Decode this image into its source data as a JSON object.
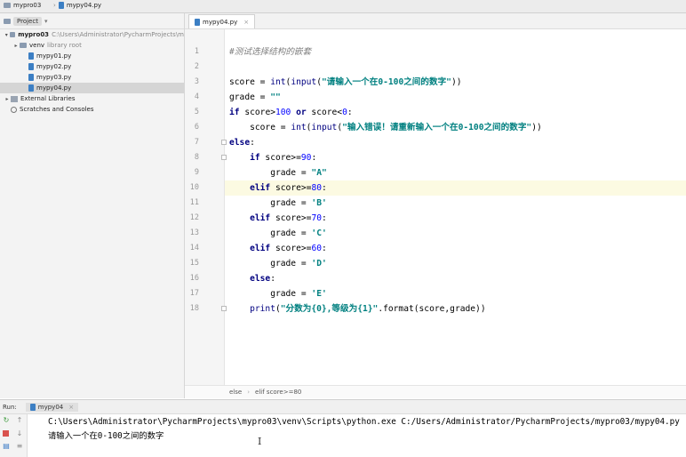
{
  "topbar": {
    "project": "mypro03",
    "file": "mypy04.py"
  },
  "sidebar": {
    "header_label": "Project",
    "tree": [
      {
        "label": "mypro03",
        "detail": "C:\\Users\\Administrator\\PycharmProjects\\m",
        "indent": 0,
        "arrow": "▾",
        "icon": "folder-icon",
        "bold": true
      },
      {
        "label": "venv",
        "detail": "library root",
        "indent": 1,
        "arrow": "▸",
        "icon": "folder-icon"
      },
      {
        "label": "mypy01.py",
        "indent": 2,
        "icon": "python-file-icon"
      },
      {
        "label": "mypy02.py",
        "indent": 2,
        "icon": "python-file-icon"
      },
      {
        "label": "mypy03.py",
        "indent": 2,
        "icon": "python-file-icon"
      },
      {
        "label": "mypy04.py",
        "indent": 2,
        "icon": "python-file-icon",
        "selected": true
      },
      {
        "label": "External Libraries",
        "indent": 0,
        "arrow": "▸",
        "icon": "library-icon"
      },
      {
        "label": "Scratches and Consoles",
        "indent": 0,
        "icon": "scratches-icon"
      }
    ]
  },
  "editor": {
    "tab_label": "mypy04.py",
    "line_numbers": [
      "1",
      "2",
      "3",
      "4",
      "5",
      "6",
      "7",
      "8",
      "9",
      "10",
      "11",
      "12",
      "13",
      "14",
      "15",
      "16",
      "17",
      "18"
    ],
    "current_line": 10,
    "breadcrumb": [
      "else",
      "elif score>=80"
    ]
  },
  "code": [
    [
      [
        "cmt",
        "#测试选择结构的嵌套"
      ]
    ],
    [],
    [
      [
        "",
        "score = "
      ],
      [
        "bi",
        "int"
      ],
      [
        "",
        "("
      ],
      [
        "bi",
        "input"
      ],
      [
        "",
        "("
      ],
      [
        "str",
        "\"请输入一个在0-100之间的数字\""
      ],
      [
        "",
        "))"
      ]
    ],
    [
      [
        "",
        "grade = "
      ],
      [
        "str",
        "\"\""
      ]
    ],
    [
      [
        "kw",
        "if"
      ],
      [
        "",
        " score>"
      ],
      [
        "num",
        "100"
      ],
      [
        "kw",
        " or"
      ],
      [
        "",
        " score<"
      ],
      [
        "num",
        "0"
      ],
      [
        "",
        ":"
      ]
    ],
    [
      [
        "",
        "    score = "
      ],
      [
        "bi",
        "int"
      ],
      [
        "",
        "("
      ],
      [
        "bi",
        "input"
      ],
      [
        "",
        "("
      ],
      [
        "str",
        "\"输入错误！请重新输入一个在0-100之间的数字\""
      ],
      [
        "",
        "))"
      ]
    ],
    [
      [
        "kw",
        "else"
      ],
      [
        "",
        ":"
      ]
    ],
    [
      [
        "kw",
        "    if"
      ],
      [
        "",
        " score>="
      ],
      [
        "num",
        "90"
      ],
      [
        "",
        ":"
      ]
    ],
    [
      [
        "",
        "        grade = "
      ],
      [
        "str",
        "\"A\""
      ]
    ],
    [
      [
        "kw",
        "    elif"
      ],
      [
        "",
        " score>="
      ],
      [
        "num",
        "80"
      ],
      [
        "",
        ":"
      ]
    ],
    [
      [
        "",
        "        grade = "
      ],
      [
        "str",
        "'B'"
      ]
    ],
    [
      [
        "kw",
        "    elif"
      ],
      [
        "",
        " score>="
      ],
      [
        "num",
        "70"
      ],
      [
        "",
        ":"
      ]
    ],
    [
      [
        "",
        "        grade = "
      ],
      [
        "str",
        "'C'"
      ]
    ],
    [
      [
        "kw",
        "    elif"
      ],
      [
        "",
        " score>="
      ],
      [
        "num",
        "60"
      ],
      [
        "",
        ":"
      ]
    ],
    [
      [
        "",
        "        grade = "
      ],
      [
        "str",
        "'D'"
      ]
    ],
    [
      [
        "kw",
        "    else"
      ],
      [
        "",
        ":"
      ]
    ],
    [
      [
        "",
        "        grade = "
      ],
      [
        "str",
        "'E'"
      ]
    ],
    [
      [
        "bi",
        "    print"
      ],
      [
        "",
        "("
      ],
      [
        "str",
        "\"分数为{0},等级为{1}\""
      ],
      [
        "",
        ".format(score,grade))"
      ]
    ]
  ],
  "run": {
    "label": "Run:",
    "tab": "mypy04",
    "console": [
      "C:\\Users\\Administrator\\PycharmProjects\\mypro03\\venv\\Scripts\\python.exe C:/Users/Administrator/PycharmProjects/mypro03/mypy04.py",
      "请输入一个在0-100之间的数字"
    ]
  }
}
